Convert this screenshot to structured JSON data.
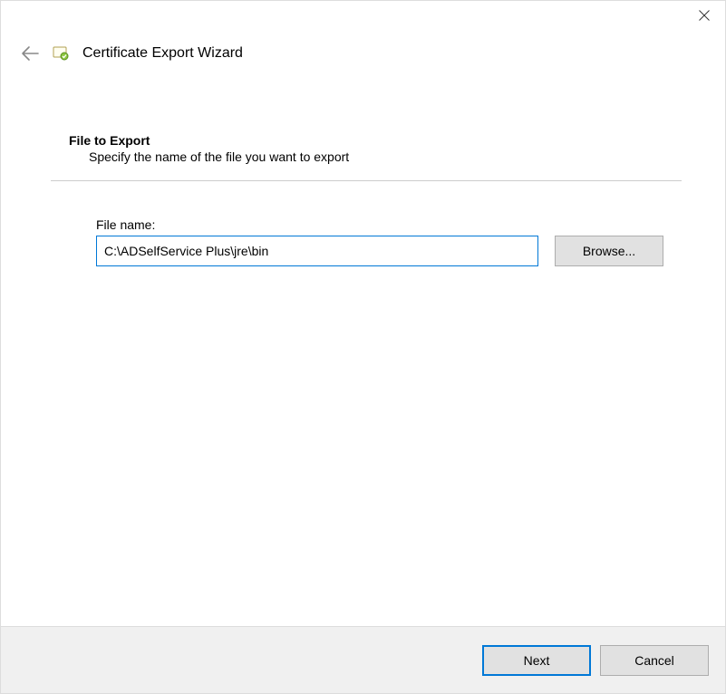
{
  "window": {
    "title": "Certificate Export Wizard"
  },
  "section": {
    "title": "File to Export",
    "description": "Specify the name of the file you want to export"
  },
  "form": {
    "fileLabel": "File name:",
    "fileValue": "C:\\ADSelfService Plus\\jre\\bin",
    "browseLabel": "Browse..."
  },
  "footer": {
    "nextLabel": "Next",
    "cancelLabel": "Cancel"
  }
}
